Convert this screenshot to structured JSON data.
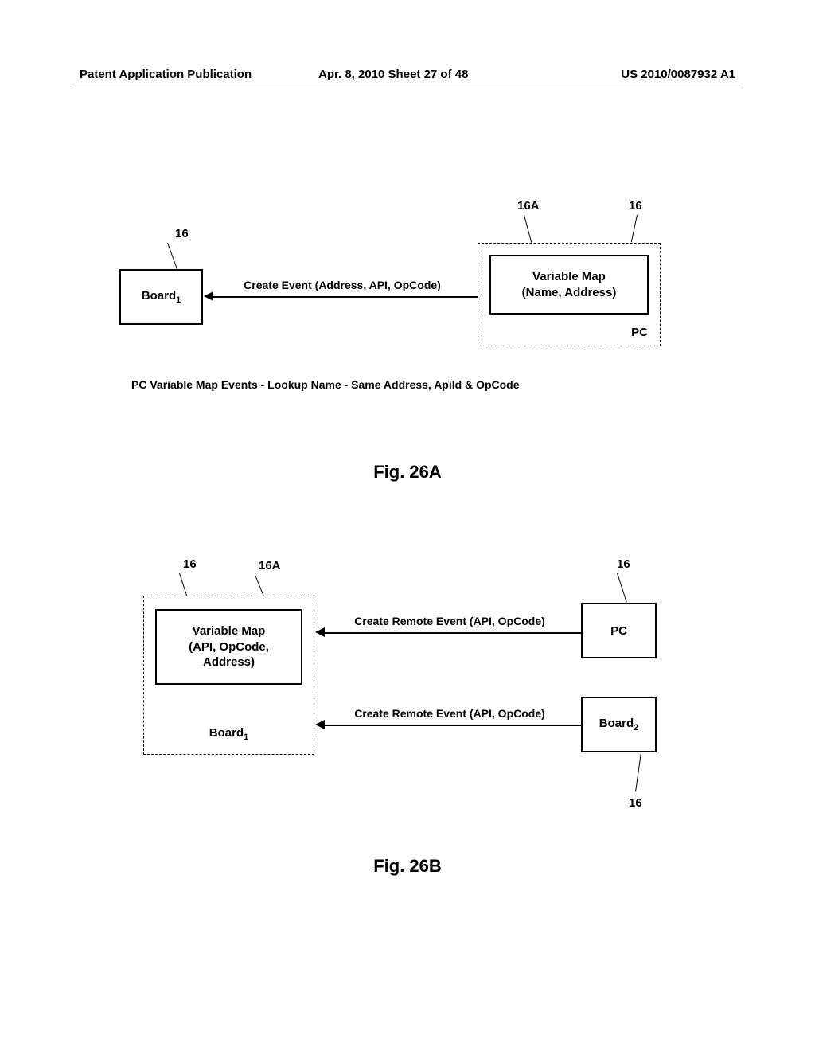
{
  "header": {
    "left": "Patent Application Publication",
    "center": "Apr. 8, 2010  Sheet 27 of 48",
    "right": "US 2010/0087932 A1"
  },
  "figA": {
    "ref_board": "16",
    "ref_pc": "16",
    "ref_varmap": "16A",
    "board_label": "Board",
    "board_sub": "1",
    "varmap_line1": "Variable Map",
    "varmap_line2": "(Name, Address)",
    "pc_label": "PC",
    "arrow_text": "Create Event (Address, API, OpCode)",
    "caption": "PC Variable Map Events - Lookup Name - Same Address, ApiId & OpCode",
    "fig_label": "Fig. 26A"
  },
  "figB": {
    "ref_board1": "16",
    "ref_varmap": "16A",
    "ref_pc": "16",
    "ref_board2": "16",
    "varmap_line1": "Variable Map",
    "varmap_line2": "(API, OpCode,",
    "varmap_line3": "Address)",
    "board1_label": "Board",
    "board1_sub": "1",
    "pc_label": "PC",
    "board2_label": "Board",
    "board2_sub": "2",
    "arrow1_text": "Create Remote Event (API, OpCode)",
    "arrow2_text": "Create Remote Event (API, OpCode)",
    "fig_label": "Fig. 26B"
  }
}
